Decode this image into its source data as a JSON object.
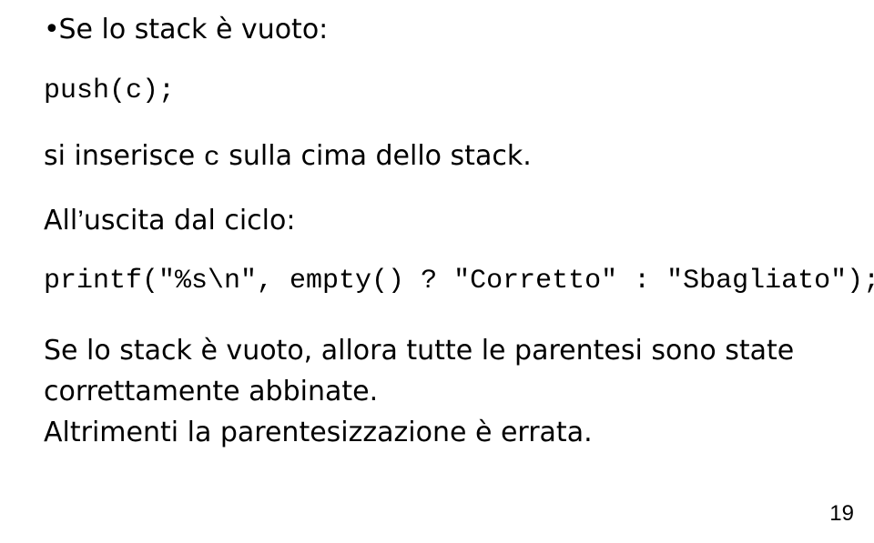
{
  "bullet": {
    "dot": "•",
    "text": "Se lo stack è vuoto:"
  },
  "code": {
    "push": "push(c);",
    "printf": "printf(\"%s\\n\", empty() ? \"Corretto\" : \"Sbagliato\");"
  },
  "body": {
    "inserisce_pre": "si inserisce ",
    "inserisce_code": "c",
    "inserisce_post": " sulla cima dello stack.",
    "uscita_pre": "All",
    "uscita_apos": "’",
    "uscita_post": "uscita dal ciclo:",
    "para2": "Se lo stack è vuoto, allora tutte le parentesi sono state correttamente abbinate.\nAltrimenti la parentesizzazione è errata."
  },
  "page_number": "19"
}
